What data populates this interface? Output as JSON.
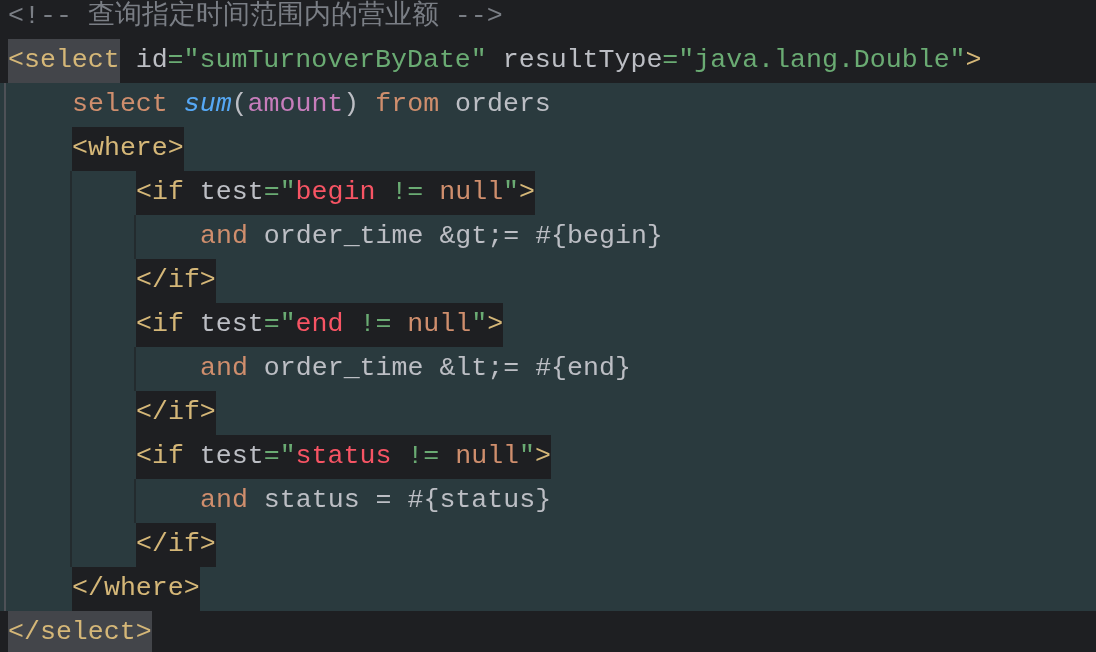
{
  "editor": {
    "lines": [
      {
        "kind": "text",
        "tokens": [
          {
            "kind": "comment",
            "text": "<!-- 查询指定时间范围内的营业额 -->"
          }
        ]
      },
      {
        "kind": "element",
        "open": [
          {
            "kind": "tag",
            "text": "<select",
            "matched": true
          },
          {
            "kind": "attr",
            "text": " id"
          },
          {
            "kind": "value",
            "text": "=\"sumTurnoverByDate\""
          },
          {
            "kind": "attr",
            "text": " resultType"
          },
          {
            "kind": "value",
            "text": "=\"java.lang.Double\""
          },
          {
            "kind": "tag",
            "text": ">",
            "matched": false
          }
        ],
        "children": [
          {
            "kind": "text",
            "tokens": [
              {
                "kind": "keyword",
                "text": "select"
              },
              {
                "kind": "function",
                "text": " sum"
              },
              {
                "kind": "plain",
                "text": "("
              },
              {
                "kind": "column",
                "text": "amount"
              },
              {
                "kind": "plain",
                "text": ")"
              },
              {
                "kind": "keyword",
                "text": " from"
              },
              {
                "kind": "plain",
                "text": " orders"
              }
            ]
          },
          {
            "kind": "element",
            "open": [
              {
                "kind": "tag",
                "text": "<where>",
                "matched": false
              }
            ],
            "children": [
              {
                "kind": "element",
                "open": [
                  {
                    "kind": "tag",
                    "text": "<if",
                    "matched": false
                  },
                  {
                    "kind": "attr",
                    "text": " test"
                  },
                  {
                    "kind": "value",
                    "text": "=\""
                  },
                  {
                    "kind": "variable",
                    "text": "begin"
                  },
                  {
                    "kind": "value",
                    "text": " != "
                  },
                  {
                    "kind": "keyword",
                    "text": "null"
                  },
                  {
                    "kind": "value",
                    "text": "\""
                  },
                  {
                    "kind": "tag",
                    "text": ">",
                    "matched": false
                  }
                ],
                "children": [
                  {
                    "kind": "text",
                    "tokens": [
                      {
                        "kind": "keyword",
                        "text": "and"
                      },
                      {
                        "kind": "plain",
                        "text": " order_time &gt;= #{begin}"
                      }
                    ]
                  }
                ],
                "close": [
                  {
                    "kind": "tag",
                    "text": "</if>",
                    "matched": false
                  }
                ]
              },
              {
                "kind": "element",
                "open": [
                  {
                    "kind": "tag",
                    "text": "<if",
                    "matched": false
                  },
                  {
                    "kind": "attr",
                    "text": " test"
                  },
                  {
                    "kind": "value",
                    "text": "=\""
                  },
                  {
                    "kind": "variable",
                    "text": "end"
                  },
                  {
                    "kind": "value",
                    "text": " != "
                  },
                  {
                    "kind": "keyword",
                    "text": "null"
                  },
                  {
                    "kind": "value",
                    "text": "\""
                  },
                  {
                    "kind": "tag",
                    "text": ">",
                    "matched": false
                  }
                ],
                "children": [
                  {
                    "kind": "text",
                    "tokens": [
                      {
                        "kind": "keyword",
                        "text": "and"
                      },
                      {
                        "kind": "plain",
                        "text": " order_time &lt;= #{end}"
                      }
                    ]
                  }
                ],
                "close": [
                  {
                    "kind": "tag",
                    "text": "</if>",
                    "matched": false
                  }
                ]
              },
              {
                "kind": "element",
                "open": [
                  {
                    "kind": "tag",
                    "text": "<if",
                    "matched": false
                  },
                  {
                    "kind": "attr",
                    "text": " test"
                  },
                  {
                    "kind": "value",
                    "text": "=\""
                  },
                  {
                    "kind": "variable",
                    "text": "status"
                  },
                  {
                    "kind": "value",
                    "text": " != "
                  },
                  {
                    "kind": "keyword",
                    "text": "null"
                  },
                  {
                    "kind": "value",
                    "text": "\""
                  },
                  {
                    "kind": "tag",
                    "text": ">",
                    "matched": false
                  }
                ],
                "children": [
                  {
                    "kind": "text",
                    "tokens": [
                      {
                        "kind": "keyword",
                        "text": "and"
                      },
                      {
                        "kind": "plain",
                        "text": " status = #{status}"
                      }
                    ]
                  }
                ],
                "close": [
                  {
                    "kind": "tag",
                    "text": "</if>",
                    "matched": false
                  }
                ]
              }
            ],
            "close": [
              {
                "kind": "tag",
                "text": "</where>",
                "matched": false
              }
            ]
          }
        ],
        "close": [
          {
            "kind": "tag",
            "text": "</select>",
            "matched": true
          }
        ]
      }
    ]
  }
}
